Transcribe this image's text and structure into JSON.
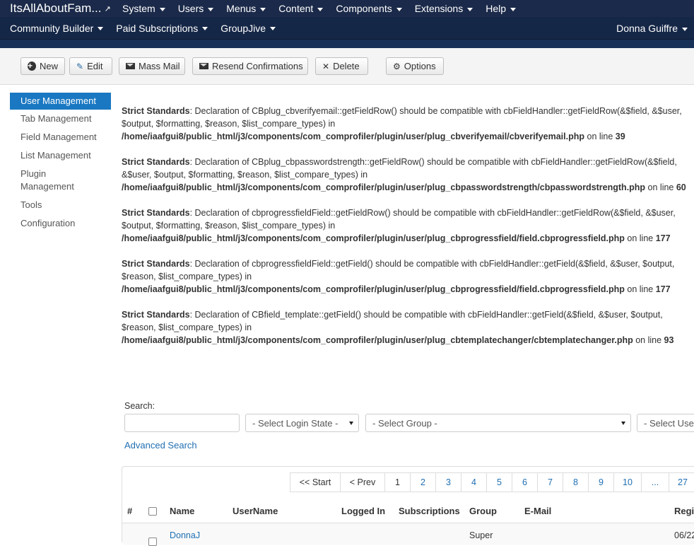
{
  "nav": {
    "site_title": "ItsAllAboutFam...",
    "menus": [
      "System",
      "Users",
      "Menus",
      "Content",
      "Components",
      "Extensions",
      "Help"
    ],
    "submenus": [
      "Community Builder",
      "Paid Subscriptions",
      "GroupJive"
    ],
    "user": "Donna Guiffre"
  },
  "toolbar": {
    "new": "New",
    "edit": "Edit",
    "mass_mail": "Mass Mail",
    "resend": "Resend Confirmations",
    "delete": "Delete",
    "options": "Options"
  },
  "sidebar": {
    "items": [
      "User Management",
      "Tab Management",
      "Field Management",
      "List Management",
      "Plugin Management",
      "Tools",
      "Configuration"
    ]
  },
  "warnings": [
    {
      "label": "Strict Standards",
      "msg": ": Declaration of CBplug_cbverifyemail::getFieldRow() should be compatible with cbFieldHandler::getFieldRow(&$field, &$user, $output, $formatting, $reason, $list_compare_types) in ",
      "path": "/home/iaafgui8/public_html/j3/components/com_comprofiler/plugin/user/plug_cbverifyemail/cbverifyemail.php",
      "online": " on line ",
      "line": "39"
    },
    {
      "label": "Strict Standards",
      "msg": ": Declaration of CBplug_cbpasswordstrength::getFieldRow() should be compatible with cbFieldHandler::getFieldRow(&$field, &$user, $output, $formatting, $reason, $list_compare_types) in ",
      "path": "/home/iaafgui8/public_html/j3/components/com_comprofiler/plugin/user/plug_cbpasswordstrength/cbpasswordstrength.php",
      "online": " on line ",
      "line": "60"
    },
    {
      "label": "Strict Standards",
      "msg": ": Declaration of cbprogressfieldField::getFieldRow() should be compatible with cbFieldHandler::getFieldRow(&$field, &$user, $output, $formatting, $reason, $list_compare_types) in ",
      "path": "/home/iaafgui8/public_html/j3/components/com_comprofiler/plugin/user/plug_cbprogressfield/field.cbprogressfield.php",
      "online": " on line ",
      "line": "177"
    },
    {
      "label": "Strict Standards",
      "msg": ": Declaration of cbprogressfieldField::getField() should be compatible with cbFieldHandler::getField(&$field, &$user, $output, $reason, $list_compare_types) in ",
      "path": "/home/iaafgui8/public_html/j3/components/com_comprofiler/plugin/user/plug_cbprogressfield/field.cbprogressfield.php",
      "online": " on line ",
      "line": "177"
    },
    {
      "label": "Strict Standards",
      "msg": ": Declaration of CBfield_template::getField() should be compatible with cbFieldHandler::getField(&$field, &$user, $output, $reason, $list_compare_types) in ",
      "path": "/home/iaafgui8/public_html/j3/components/com_comprofiler/plugin/user/plug_cbtemplatechanger/cbtemplatechanger.php",
      "online": " on line ",
      "line": "93"
    }
  ],
  "filters": {
    "search_label": "Search:",
    "login_state": "- Select Login State -",
    "group": "- Select Group -",
    "user_type": "- Select Use",
    "advanced": "Advanced Search"
  },
  "pager": [
    "<< Start",
    "< Prev",
    "1",
    "2",
    "3",
    "4",
    "5",
    "6",
    "7",
    "8",
    "9",
    "10",
    "...",
    "27"
  ],
  "table": {
    "headers": [
      "#",
      "Name",
      "UserName",
      "Logged In",
      "Subscriptions",
      "Group",
      "E-Mail",
      "Regi"
    ],
    "row1": {
      "name": "DonnaJ",
      "group": "Super",
      "date": "06/22"
    }
  }
}
